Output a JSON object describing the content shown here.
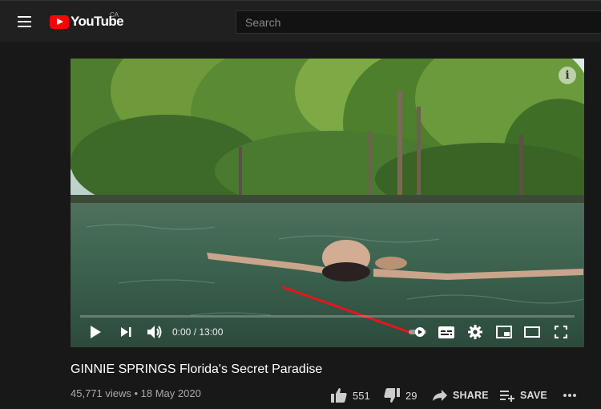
{
  "header": {
    "logo_text": "YouTube",
    "country_code": "CA",
    "search_placeholder": "Search"
  },
  "player": {
    "current_time": "0:00",
    "duration": "13:00",
    "time_display": "0:00 / 13:00",
    "info_glyph": "i",
    "progress_fraction": 0,
    "annotation_color": "#e8141c"
  },
  "video": {
    "title": "GINNIE SPRINGS Florida's Secret Paradise",
    "views": "45,771 views",
    "separator": "•",
    "date": "18 May 2020",
    "meta_text": "45,771 views • 18 May 2020"
  },
  "actions": {
    "likes": "551",
    "dislikes": "29",
    "share_label": "SHARE",
    "save_label": "SAVE"
  },
  "colors": {
    "brand_red": "#ff0000",
    "background": "#181818",
    "masthead": "#202020"
  }
}
